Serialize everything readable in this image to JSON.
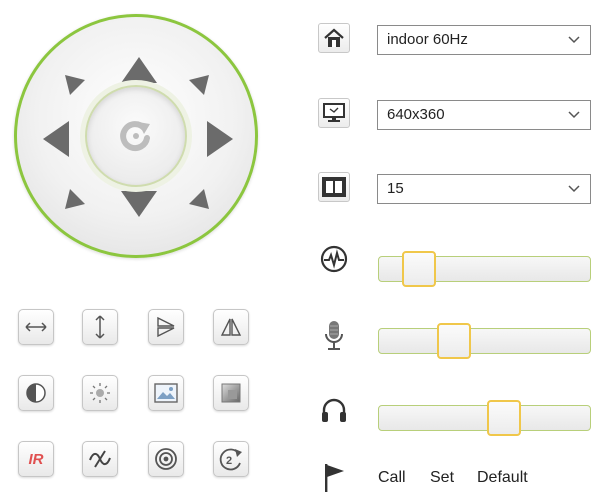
{
  "ptz": {
    "directions": [
      "up",
      "down",
      "left",
      "right",
      "up-left",
      "up-right",
      "down-left",
      "down-right"
    ],
    "center_icon": "refresh-icon"
  },
  "image_buttons": {
    "row1": [
      "flip-horizontal-icon",
      "flip-vertical-icon",
      "mirror-icon",
      "flip-icon"
    ],
    "row2": [
      "contrast-icon",
      "brightness-icon",
      "image-icon",
      "saturation-icon"
    ],
    "row3": {
      "ir_label": "IR",
      "icons": [
        "infrared-icon",
        "no-flicker-icon",
        "patrol-icon",
        "patrol-speed-icon"
      ]
    }
  },
  "settings": {
    "mode": {
      "icon": "house-icon",
      "value": "indoor 60Hz"
    },
    "resolution": {
      "icon": "monitor-icon",
      "value": "640x360"
    },
    "frame_rate": {
      "icon": "film-icon",
      "value": "15"
    }
  },
  "sliders": {
    "quality": {
      "icon": "wave-icon",
      "level": 0.13
    },
    "microphone": {
      "icon": "microphone-icon",
      "level": 0.33
    },
    "speaker": {
      "icon": "headphones-icon",
      "level": 0.61
    }
  },
  "preset": {
    "icon": "flag-icon",
    "call_label": "Call",
    "set_label": "Set",
    "default_label": "Default"
  },
  "colors": {
    "accent_green": "#8cc63f",
    "thumb_yellow": "#f0c74a",
    "arrow_gray": "#6b6b6b"
  }
}
